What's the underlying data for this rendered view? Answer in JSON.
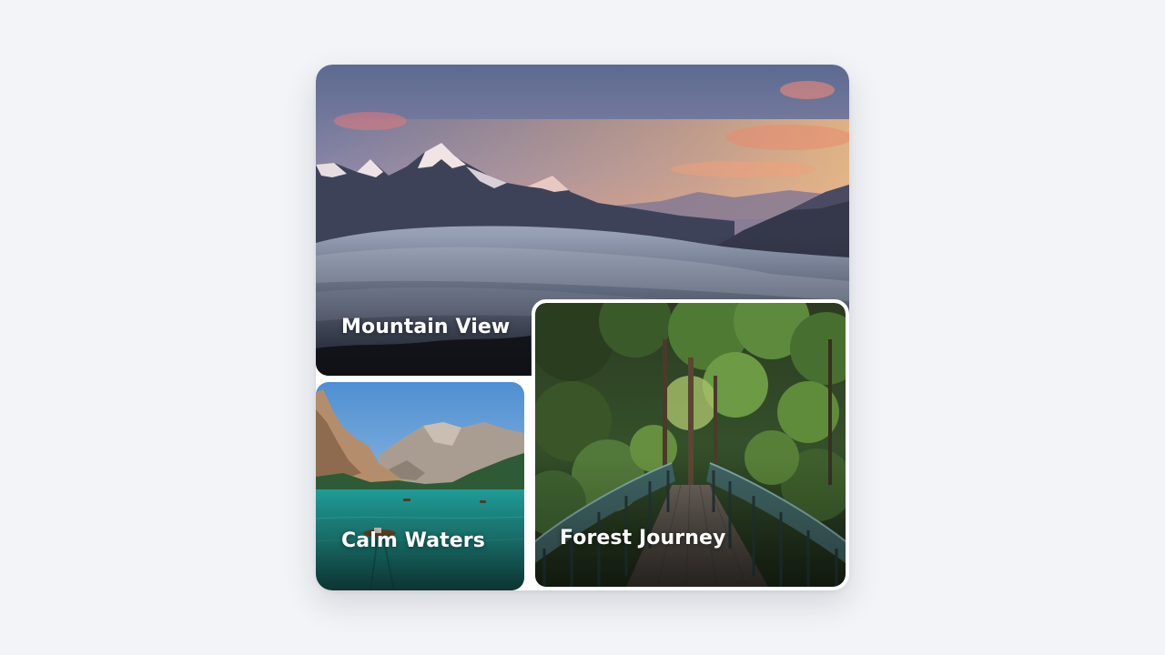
{
  "gallery": {
    "cards": [
      {
        "id": "mountain",
        "title": "Mountain View"
      },
      {
        "id": "waters",
        "title": "Calm Waters"
      },
      {
        "id": "forest",
        "title": "Forest Journey"
      }
    ]
  },
  "colors": {
    "page_background": "#f2f4f7",
    "card_border": "#ffffff",
    "caption_text": "#ffffff"
  }
}
